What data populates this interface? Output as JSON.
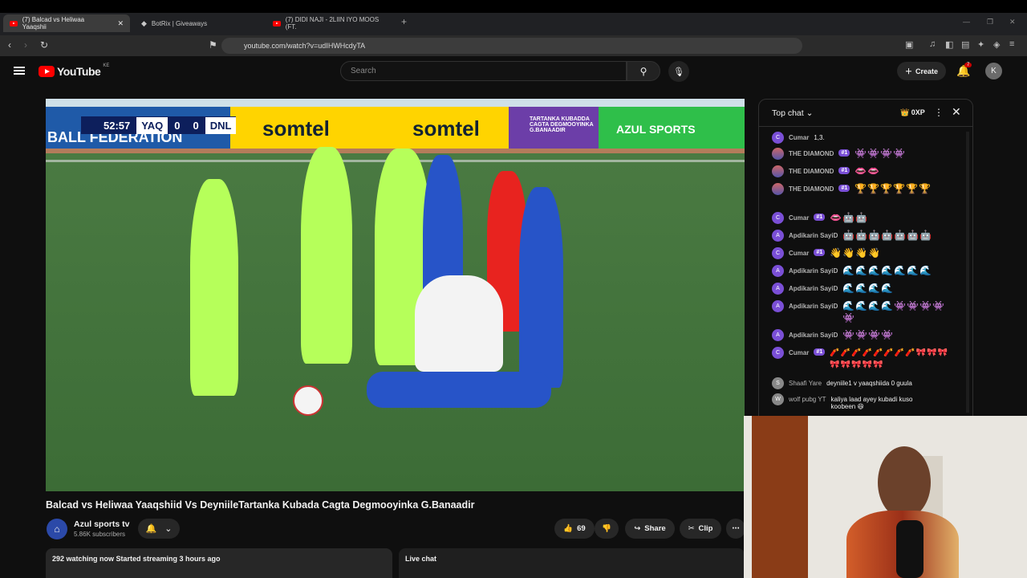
{
  "browser": {
    "tabs": [
      {
        "label": "(7) Balcad vs Heliwaa Yaaqshii",
        "active": true
      },
      {
        "label": "BotRix | Giveaways",
        "active": false
      },
      {
        "label": "(7) DIDI NAJI - 2LIIN IYO MOOS (FT.",
        "active": false
      }
    ],
    "url": "youtube.com/watch?v=udIHWHcdyTA"
  },
  "yt": {
    "logo_text": "YouTube",
    "country": "KE",
    "search_placeholder": "Search",
    "create_label": "Create",
    "notif_count": "7",
    "avatar_letter": "K"
  },
  "video": {
    "scoreboard": {
      "time": "52:57",
      "home": "YAQ",
      "home_score": "0",
      "away_score": "0",
      "away": "DNL"
    },
    "ad_texts": [
      "BALL FEDERATION",
      "somtel",
      "somtel",
      "TARTANKA KUBADDA CAGTA DEGMOOYINKA G.BANAADIR",
      "AZUL SPORTS"
    ],
    "title": "Balcad vs Heliwaa Yaaqshiid Vs DeyniileTartanka Kubada Cagta Degmooyinka G.Banaadir"
  },
  "channel": {
    "name": "Azul sports tv",
    "subs": "5.86K subscribers",
    "likes": "69",
    "share": "Share",
    "clip": "Clip"
  },
  "info": {
    "watching": "292 watching now  Started streaming 3 hours ago",
    "live_chat": "Live chat"
  },
  "chat": {
    "header": "Top chat",
    "xp": "0XP",
    "messages": [
      {
        "avatar": "C",
        "user": "Cumar",
        "text": "1,3."
      },
      {
        "avatar": "D",
        "user": "THE DIAMOND",
        "rank": "#1",
        "emojis": "👾👾👾👾"
      },
      {
        "avatar": "D",
        "user": "THE DIAMOND",
        "rank": "#1",
        "emojis": "👄👄"
      },
      {
        "avatar": "D",
        "user": "THE DIAMOND",
        "rank": "#1",
        "emojis": "🏆🏆🏆🏆🏆🏆"
      },
      {
        "avatar": "C",
        "user": "Cumar",
        "rank": "#1",
        "emojis": "👄🤖🤖"
      },
      {
        "avatar": "A",
        "user": "Apdikarin SayiD",
        "emojis": "🤖🤖🤖🤖🤖🤖🤖"
      },
      {
        "avatar": "C",
        "user": "Cumar",
        "rank": "#1",
        "emojis": "👋👋👋👋"
      },
      {
        "avatar": "A",
        "user": "Apdikarin SayiD",
        "emojis": "🌊🌊🌊🌊🌊🌊🌊"
      },
      {
        "avatar": "A",
        "user": "Apdikarin SayiD",
        "emojis": "🌊🌊🌊🌊"
      },
      {
        "avatar": "A",
        "user": "Apdikarin SayiD",
        "emojis": "🌊🌊🌊🌊👾👾👾👾👾"
      },
      {
        "avatar": "A",
        "user": "Apdikarin SayiD",
        "emojis": "👾👾👾👾"
      },
      {
        "avatar": "C",
        "user": "Cumar",
        "rank": "#1",
        "emojis": "🧨🧨🧨🧨🧨🧨🧨🧨🎀🎀🎀🎀🎀🎀🎀🎀"
      },
      {
        "avatar": "S",
        "user": "Shaafi Yare",
        "text": "deyniile1 v yaaqshiida 0 guula"
      },
      {
        "avatar": "W",
        "user": "wolf pubg YT",
        "text": "kaliya laad ayey kubadi kuso koobeen 😆"
      }
    ]
  }
}
